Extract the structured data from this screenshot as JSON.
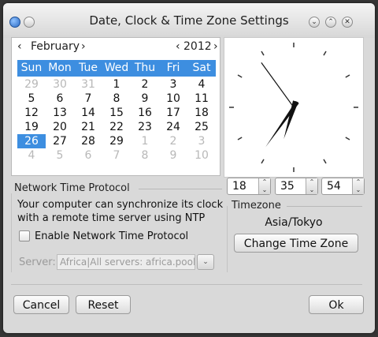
{
  "window": {
    "title": "Date, Clock & Time Zone Settings",
    "shade_glyph": "⌄",
    "restore_glyph": "⌃",
    "close_glyph": "✕"
  },
  "calendar": {
    "prev_month": "‹",
    "month": "February",
    "next_month": "›",
    "prev_year": "‹",
    "year": "2012",
    "next_year": "›",
    "weekdays": [
      "Sun",
      "Mon",
      "Tue",
      "Wed",
      "Thu",
      "Fri",
      "Sat"
    ],
    "days": [
      {
        "d": "29",
        "other": true
      },
      {
        "d": "30",
        "other": true
      },
      {
        "d": "31",
        "other": true
      },
      {
        "d": "1"
      },
      {
        "d": "2"
      },
      {
        "d": "3"
      },
      {
        "d": "4"
      },
      {
        "d": "5"
      },
      {
        "d": "6"
      },
      {
        "d": "7"
      },
      {
        "d": "8"
      },
      {
        "d": "9"
      },
      {
        "d": "10"
      },
      {
        "d": "11"
      },
      {
        "d": "12"
      },
      {
        "d": "13"
      },
      {
        "d": "14"
      },
      {
        "d": "15"
      },
      {
        "d": "16"
      },
      {
        "d": "17"
      },
      {
        "d": "18"
      },
      {
        "d": "19"
      },
      {
        "d": "20"
      },
      {
        "d": "21"
      },
      {
        "d": "22"
      },
      {
        "d": "23"
      },
      {
        "d": "24"
      },
      {
        "d": "25"
      },
      {
        "d": "26",
        "selected": true
      },
      {
        "d": "27"
      },
      {
        "d": "28"
      },
      {
        "d": "29"
      },
      {
        "d": "1",
        "other": true
      },
      {
        "d": "2",
        "other": true
      },
      {
        "d": "3",
        "other": true
      },
      {
        "d": "4",
        "other": true
      },
      {
        "d": "5",
        "other": true
      },
      {
        "d": "6",
        "other": true
      },
      {
        "d": "7",
        "other": true
      },
      {
        "d": "8",
        "other": true
      },
      {
        "d": "9",
        "other": true
      },
      {
        "d": "10",
        "other": true
      }
    ],
    "selected_color": "#3d8ee0"
  },
  "clock": {
    "hours": 18,
    "minutes": 35,
    "seconds": 54
  },
  "time": {
    "hours": "18",
    "minutes": "35",
    "seconds": "54",
    "up": "⌃",
    "down": "⌄"
  },
  "ntp": {
    "title": "Network Time Protocol",
    "description": "Your computer can synchronize its clock with a remote time server using NTP",
    "checkbox_label": "Enable Network Time Protocol",
    "enabled": false,
    "server_label": "Server:",
    "server_value": "Africa|All servers: africa.pool.ntp.org",
    "dropdown": "⌄"
  },
  "timezone": {
    "title": "Timezone",
    "name": "Asia/Tokyo",
    "change_button": "Change Time Zone"
  },
  "footer": {
    "cancel": "Cancel",
    "reset": "Reset",
    "ok": "Ok"
  }
}
